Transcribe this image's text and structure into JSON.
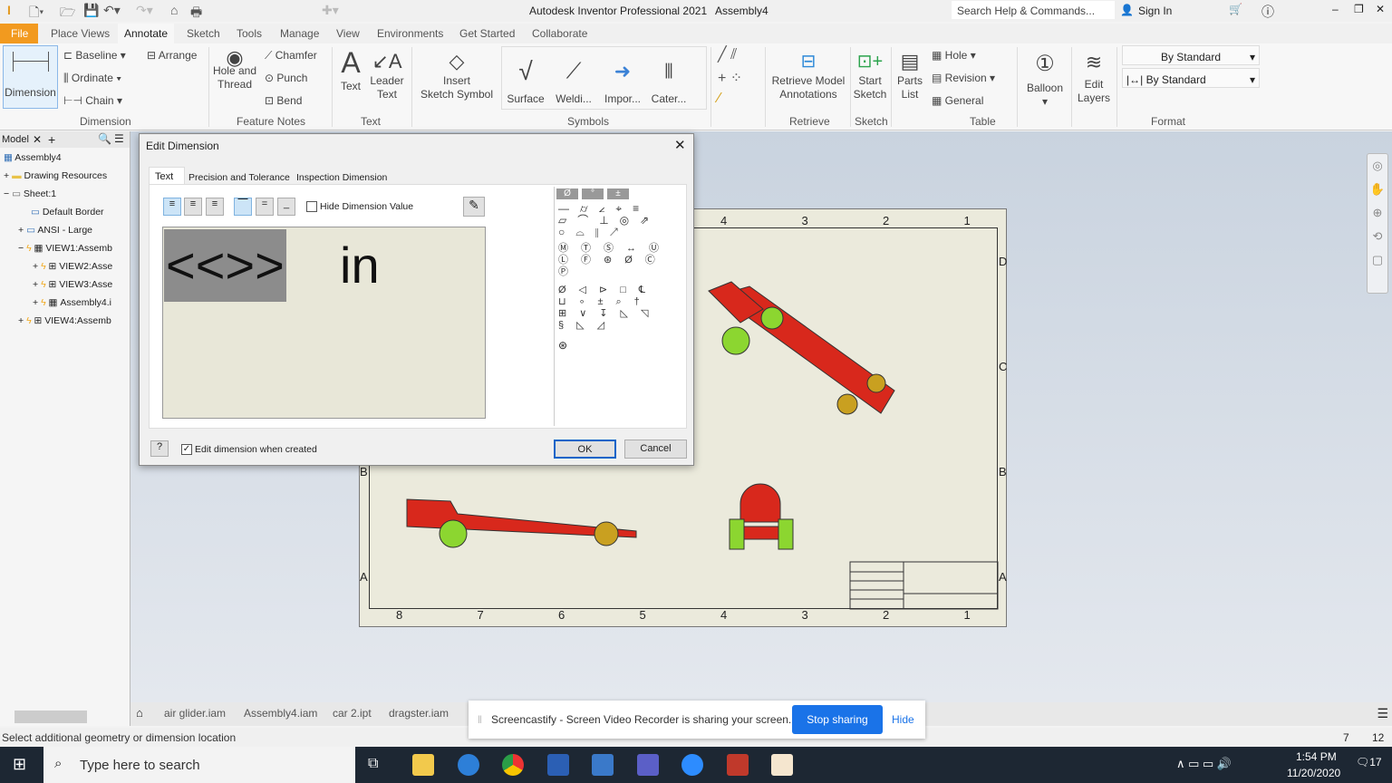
{
  "app": {
    "title": "Autodesk Inventor Professional 2021",
    "document": "Assembly4",
    "search_placeholder": "Search Help & Commands...",
    "sign_in": "Sign In"
  },
  "tabs": [
    "File",
    "Place Views",
    "Annotate",
    "Sketch",
    "Tools",
    "Manage",
    "View",
    "Environments",
    "Get Started",
    "Collaborate"
  ],
  "ribbon": {
    "dimension": {
      "big": "Dimension",
      "baseline": "Baseline",
      "ordinate": "Ordinate",
      "chain": "Chain",
      "arrange": "Arrange",
      "group": "Dimension"
    },
    "feature_notes": {
      "hole": "Hole and",
      "thread": "Thread",
      "chamfer": "Chamfer",
      "punch": "Punch",
      "bend": "Bend",
      "group": "Feature Notes"
    },
    "text": {
      "text": "Text",
      "leader1": "Leader",
      "leader2": "Text",
      "group": "Text"
    },
    "symbols": {
      "insert1": "Insert",
      "insert2": "Sketch Symbol",
      "surface": "Surface",
      "weld": "Weldi...",
      "import": "Impor...",
      "cater": "Cater...",
      "group": "Symbols"
    },
    "retrieve": {
      "l1": "Retrieve Model",
      "l2": "Annotations",
      "group": "Retrieve"
    },
    "sketch": {
      "l1": "Start",
      "l2": "Sketch",
      "group": "Sketch"
    },
    "table": {
      "parts1": "Parts",
      "parts2": "List",
      "hole": "Hole",
      "revision": "Revision",
      "general": "General",
      "group": "Table"
    },
    "balloon": "Balloon",
    "layers": {
      "l1": "Edit",
      "l2": "Layers"
    },
    "format": {
      "style": "By Standard",
      "dimstyle": "By Standard",
      "group": "Format"
    }
  },
  "browser": {
    "tab": "Model",
    "items": [
      "Assembly4",
      "Drawing Resources",
      "Sheet:1",
      "Default Border",
      "ANSI - Large",
      "VIEW1:Assemb",
      "VIEW2:Asse",
      "VIEW3:Asse",
      "Assembly4.i",
      "VIEW4:Assemb"
    ]
  },
  "dialog": {
    "title": "Edit Dimension",
    "tabs": [
      "Text",
      "Precision and Tolerance",
      "Inspection Dimension"
    ],
    "hide_value": "Hide Dimension Value",
    "text_selected": "<<>>",
    "text_rest": "in",
    "edit_when_created": "Edit dimension when created",
    "ok": "OK",
    "cancel": "Cancel",
    "symbol_tabs": [
      "Ø",
      "°",
      "±"
    ]
  },
  "sheet": {
    "cols": [
      "8",
      "7",
      "6",
      "5",
      "4",
      "3",
      "2",
      "1"
    ],
    "top_cols": [
      "4",
      "3",
      "2",
      "1"
    ],
    "rows": [
      "D",
      "C",
      "B",
      "A"
    ]
  },
  "doc_tabs": [
    "air glider.iam",
    "Assembly4.iam",
    "car 2.ipt",
    "dragster.iam"
  ],
  "screencastify": {
    "message": "Screencastify - Screen Video Recorder is sharing your screen.",
    "stop": "Stop sharing",
    "hide": "Hide"
  },
  "status": {
    "prompt": "Select additional geometry or dimension location",
    "n1": "7",
    "n2": "12"
  },
  "taskbar": {
    "search": "Type here to search",
    "time": "1:54 PM",
    "date": "11/20/2020",
    "notifications": "17"
  },
  "colors": {
    "file_tab": "#f29a1f",
    "accent": "#1a73e8",
    "car_body": "#d8281c",
    "wheel": "#8cd630"
  }
}
